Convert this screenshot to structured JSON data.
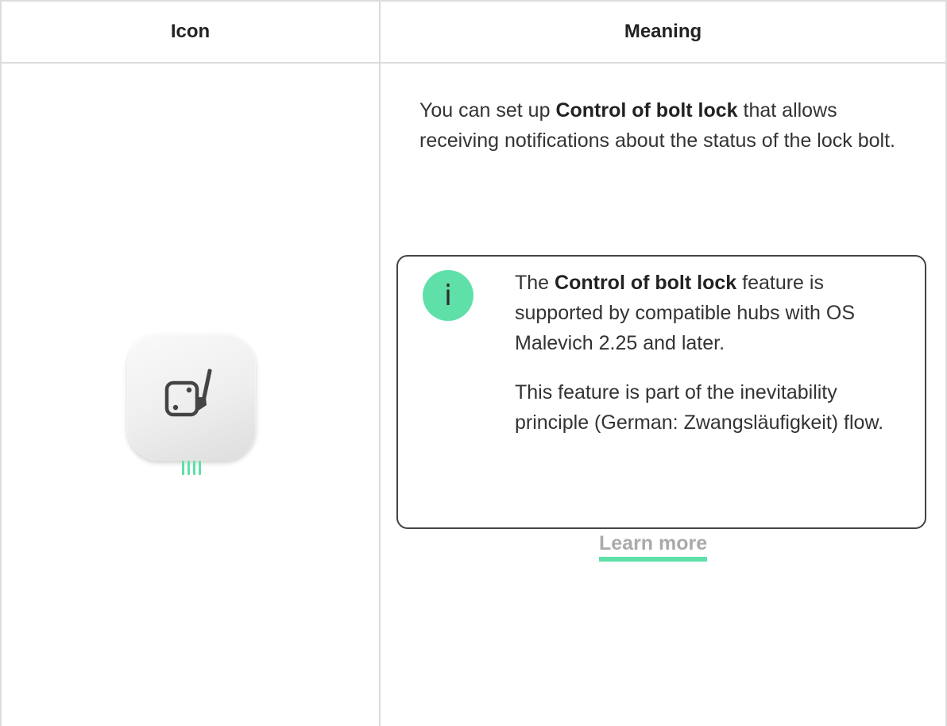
{
  "table": {
    "headers": {
      "icon": "Icon",
      "meaning": "Meaning"
    }
  },
  "row": {
    "icon_name": "bolt-lock-control-device-icon",
    "intro": {
      "before": "You can set up ",
      "bold": "Control of bolt lock",
      "after": " that allows receiving notifications about the status of the lock bolt."
    },
    "note": {
      "badge": "i",
      "p1_before": "The ",
      "p1_bold": "Control of bolt lock",
      "p1_after": " feature is supported by compatible hubs with OS Malevich 2.25 and later.",
      "p2": "This feature is part of the inevitability principle (German: Zwangsläufigkeit) flow.",
      "link": "Learn more"
    }
  },
  "colors": {
    "accent": "#5fe0a8",
    "border": "#dcdcdc",
    "text": "#333333",
    "link": "#aaaaaa"
  }
}
